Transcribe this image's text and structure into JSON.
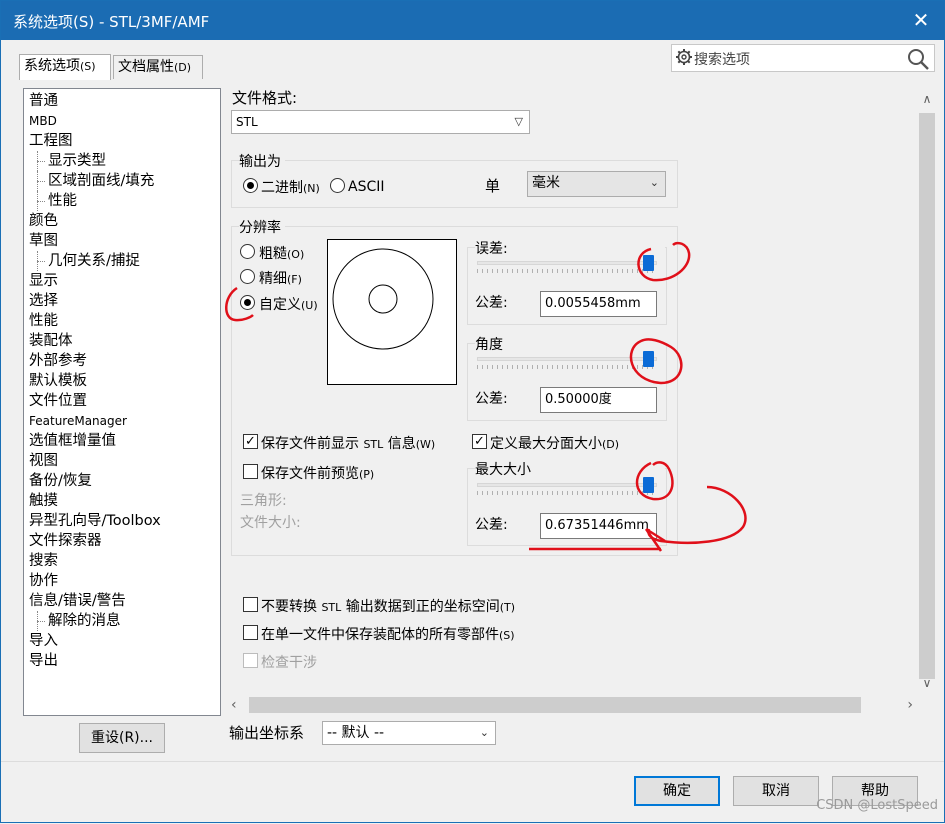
{
  "window": {
    "title": "系统选项(S) - STL/3MF/AMF",
    "close_glyph": "✕"
  },
  "tabs": [
    {
      "label": "系统选项",
      "hotkey": "(S)"
    },
    {
      "label": "文档属性",
      "hotkey": "(D)"
    }
  ],
  "search": {
    "placeholder": "搜索选项",
    "icon": "search-icon"
  },
  "tree": [
    {
      "label": "普通"
    },
    {
      "label": "MBD"
    },
    {
      "label": "工程图"
    },
    {
      "label": "显示类型"
    },
    {
      "label": "区域剖面线/填充"
    },
    {
      "label": "性能"
    },
    {
      "label": "颜色"
    },
    {
      "label": "草图"
    },
    {
      "label": "几何关系/捕捉"
    },
    {
      "label": "显示"
    },
    {
      "label": "选择"
    },
    {
      "label": "性能"
    },
    {
      "label": "装配体"
    },
    {
      "label": "外部参考"
    },
    {
      "label": "默认模板"
    },
    {
      "label": "文件位置"
    },
    {
      "label": "FeatureManager"
    },
    {
      "label": "选值框增量值"
    },
    {
      "label": "视图"
    },
    {
      "label": "备份/恢复"
    },
    {
      "label": "触摸"
    },
    {
      "label": "异型孔向导/Toolbox"
    },
    {
      "label": "文件探索器"
    },
    {
      "label": "搜索"
    },
    {
      "label": "协作"
    },
    {
      "label": "信息/错误/警告"
    },
    {
      "label": "解除的消息"
    },
    {
      "label": "导入"
    },
    {
      "label": "导出"
    }
  ],
  "reset_button": "重设(R)...",
  "format": {
    "label": "文件格式:",
    "value": "STL"
  },
  "output": {
    "group_title": "输出为",
    "binary": "二进制",
    "binary_hotkey": "(N)",
    "ascii": "ASCII",
    "unit_label": "单",
    "unit_value": "毫米"
  },
  "resolution": {
    "group_title": "分辨率",
    "coarse": "粗糙",
    "coarse_hotkey": "(O)",
    "fine": "精细",
    "fine_hotkey": "(F)",
    "custom": "自定义",
    "custom_hotkey": "(U)",
    "selected": "custom",
    "deviation_title": "误差:",
    "deviation_tol_label": "公差:",
    "deviation_value": "0.0055458mm",
    "angle_title": "角度",
    "angle_tol_label": "公差:",
    "angle_value": "0.50000度",
    "max_title": "最大大小",
    "max_tol_label": "公差:",
    "max_value": "0.67351446mm",
    "deviation_slider": 0.98,
    "angle_slider": 0.98,
    "max_slider": 0.98
  },
  "options": {
    "show_info": "保存文件前显示",
    "show_info_stl": "STL",
    "show_info_tail": "信息",
    "show_info_hotkey": "(W)",
    "show_info_checked": true,
    "preview": "保存文件前预览",
    "preview_hotkey": "(P)",
    "preview_checked": false,
    "max_facet": "定义最大分面大小",
    "max_facet_hotkey": "(D)",
    "max_facet_checked": true,
    "triangles_label": "三角形:",
    "filesize_label": "文件大小:"
  },
  "bottom_checks": {
    "no_transform": "不要转换",
    "no_transform_stl": "STL",
    "no_transform_tail": "输出数据到正的坐标空间",
    "no_transform_hotkey": "(T)",
    "single_file": "在单一文件中保存装配体的所有零部件",
    "single_file_hotkey": "(S)",
    "interference": "检查干涉"
  },
  "coord": {
    "label": "输出坐标系",
    "value": "-- 默认 --"
  },
  "buttons": {
    "ok": "确定",
    "cancel": "取消",
    "help": "帮助"
  },
  "watermark": "CSDN @LostSpeed",
  "colors": {
    "titlebar": "#1b6cb3",
    "slider_thumb": "#0b6bd6",
    "annotation": "#e0101a"
  }
}
